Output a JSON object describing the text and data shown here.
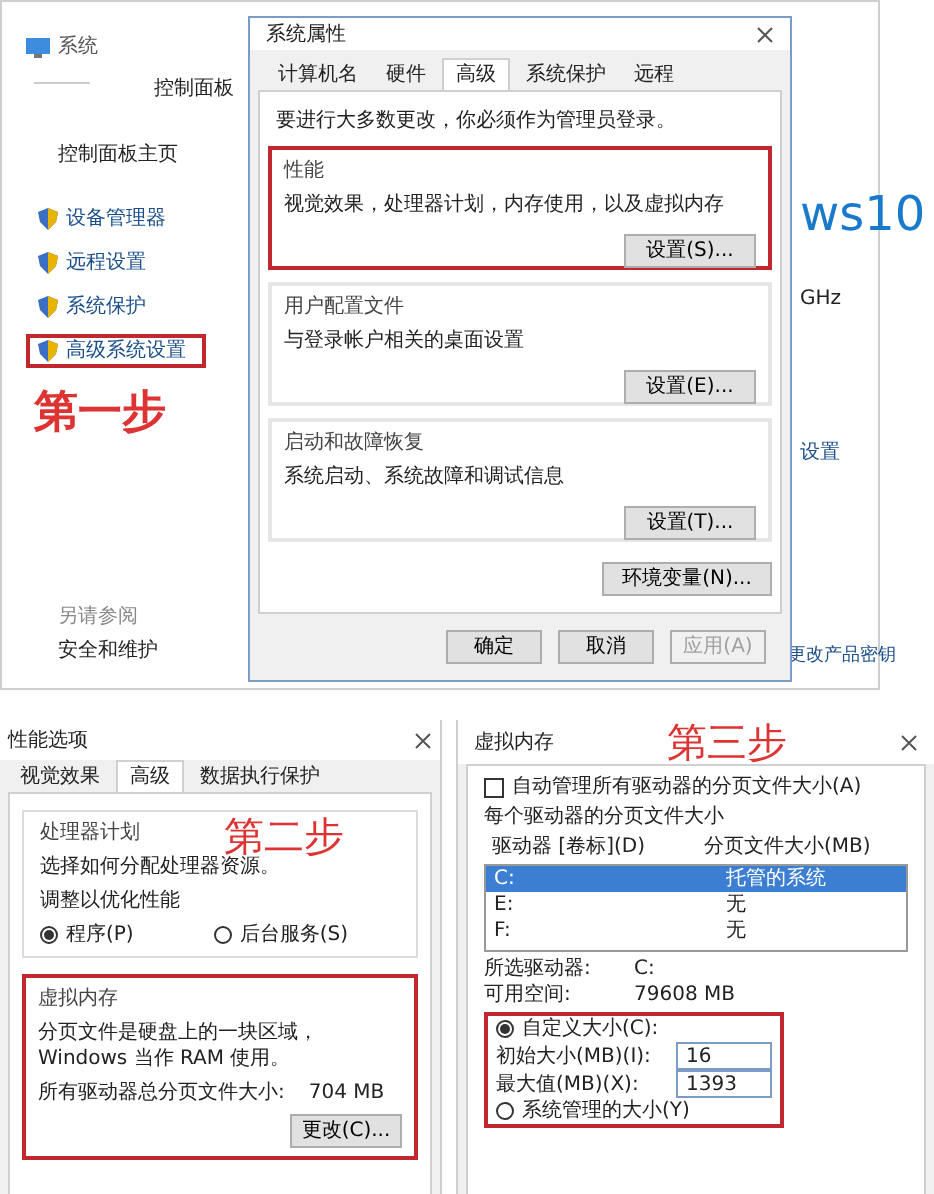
{
  "control_panel": {
    "title": "系统",
    "breadcrumb": "控制面板",
    "home_link": "控制面板主页",
    "links": [
      {
        "label": "设备管理器",
        "highlighted": false
      },
      {
        "label": "远程设置",
        "highlighted": false
      },
      {
        "label": "系统保护",
        "highlighted": false
      },
      {
        "label": "高级系统设置",
        "highlighted": true
      }
    ],
    "step_label": "第一步",
    "see_also": "另请参阅",
    "see_also_link": "安全和维护",
    "edition_text": "ws10",
    "cpu_text": "GHz",
    "settings_link": "设置",
    "product_key_link": "更改产品密钥"
  },
  "system_properties": {
    "title": "系统属性",
    "tabs": [
      {
        "label": "计算机名",
        "selected": false
      },
      {
        "label": "硬件",
        "selected": false
      },
      {
        "label": "高级",
        "selected": true
      },
      {
        "label": "系统保护",
        "selected": false
      },
      {
        "label": "远程",
        "selected": false
      }
    ],
    "notice": "要进行大多数更改，你必须作为管理员登录。",
    "groups": [
      {
        "title": "性能",
        "description": "视觉效果，处理器计划，内存使用，以及虚拟内存",
        "button": "设置(S)...",
        "highlighted": true
      },
      {
        "title": "用户配置文件",
        "description": "与登录帐户相关的桌面设置",
        "button": "设置(E)...",
        "highlighted": false
      },
      {
        "title": "启动和故障恢复",
        "description": "系统启动、系统故障和调试信息",
        "button": "设置(T)...",
        "highlighted": false
      }
    ],
    "env_button": "环境变量(N)...",
    "buttons": [
      {
        "label": "确定",
        "disabled": false
      },
      {
        "label": "取消",
        "disabled": false
      },
      {
        "label": "应用(A)",
        "disabled": true
      }
    ]
  },
  "performance_options": {
    "title": "性能选项",
    "tabs": [
      {
        "label": "视觉效果",
        "selected": false
      },
      {
        "label": "高级",
        "selected": true
      },
      {
        "label": "数据执行保护",
        "selected": false
      }
    ],
    "step_label": "第二步",
    "processor": {
      "title": "处理器计划",
      "description": "选择如何分配处理器资源。",
      "prompt": "调整以优化性能",
      "radios": [
        {
          "label": "程序(P)",
          "selected": true
        },
        {
          "label": "后台服务(S)",
          "selected": false
        }
      ]
    },
    "memory": {
      "title": "虚拟内存",
      "description": "分页文件是硬盘上的一块区域，Windows 当作 RAM 使用。",
      "total_label": "所有驱动器总分页文件大小:",
      "total_value": "704 MB",
      "button": "更改(C)...",
      "highlighted": true
    }
  },
  "virtual_memory": {
    "title": "虚拟内存",
    "step_label": "第三步",
    "auto_manage": {
      "label": "自动管理所有驱动器的分页文件大小(A)",
      "checked": false
    },
    "section_label": "每个驱动器的分页文件大小",
    "columns": [
      "驱动器 [卷标](D)",
      "分页文件大小(MB)"
    ],
    "drives": [
      {
        "drive": "C:",
        "size": "托管的系统",
        "selected": true
      },
      {
        "drive": "E:",
        "size": "无",
        "selected": false
      },
      {
        "drive": "F:",
        "size": "无",
        "selected": false
      }
    ],
    "selected_drive_label": "所选驱动器:",
    "selected_drive": "C:",
    "free_space_label": "可用空间:",
    "free_space": "79608 MB",
    "custom": {
      "label": "自定义大小(C):",
      "selected": true,
      "highlighted": true
    },
    "fields": [
      {
        "label": "初始大小(MB)(I):",
        "value": "16"
      },
      {
        "label": "最大值(MB)(X):",
        "value": "1393"
      }
    ],
    "system_managed": {
      "label": "系统管理的大小(Y)",
      "selected": false
    }
  }
}
